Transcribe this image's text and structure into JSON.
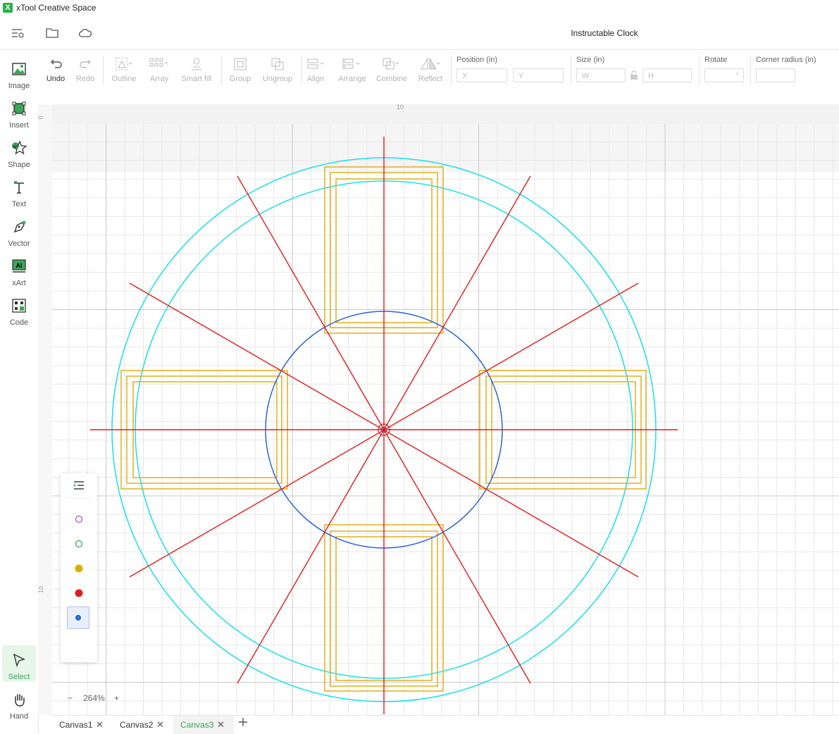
{
  "app": {
    "title": "xTool Creative Space",
    "logo_glyph": "X"
  },
  "document": {
    "title": "Instructable Clock"
  },
  "sidebar": {
    "tools": [
      {
        "label": "Image",
        "icon": "image-icon"
      },
      {
        "label": "Insert",
        "icon": "insert-icon"
      },
      {
        "label": "Shape",
        "icon": "star-icon"
      },
      {
        "label": "Text",
        "icon": "text-icon"
      },
      {
        "label": "Vector",
        "icon": "pen-icon"
      },
      {
        "label": "xArt",
        "icon": "ai-icon"
      },
      {
        "label": "Code",
        "icon": "qr-code-icon"
      }
    ],
    "bottom_tools": [
      {
        "label": "Select",
        "icon": "cursor-icon",
        "active": true
      },
      {
        "label": "Hand",
        "icon": "hand-icon"
      }
    ]
  },
  "toolbar": {
    "undo": "Undo",
    "redo": "Redo",
    "outline": "Outline",
    "array": "Array",
    "smart_fill": "Smart fill",
    "group": "Group",
    "ungroup": "Ungroup",
    "align": "Align",
    "arrange": "Arrange",
    "combine": "Combine",
    "reflect": "Reflect",
    "position_label": "Position (in)",
    "x_placeholder": "X",
    "y_placeholder": "Y",
    "size_label": "Size (in)",
    "w_placeholder": "W",
    "h_placeholder": "H",
    "rotate_label": "Rotate",
    "rotate_unit": "°",
    "corner_label": "Corner radius (in)"
  },
  "rulers": {
    "top_tick": "10",
    "left_tick_top": "0",
    "left_tick_bottom": "10"
  },
  "layers": [
    {
      "color": "#b04bd1",
      "filled": false
    },
    {
      "color": "#2fa84f",
      "filled": false
    },
    {
      "color": "#d8b000",
      "filled": true
    },
    {
      "color": "#e02020",
      "filled": true
    },
    {
      "color": "#2f6fe8",
      "filled": true,
      "selected": true
    }
  ],
  "zoom": {
    "level": "264%",
    "minus": "−",
    "plus": "+"
  },
  "tabs": [
    {
      "label": "Canvas1",
      "active": false
    },
    {
      "label": "Canvas2",
      "active": false
    },
    {
      "label": "Canvas3",
      "active": true
    }
  ],
  "colors": {
    "cyan_circle": "#19e0e8",
    "blue_circle": "#2b63d9",
    "red_line": "#e51b1b",
    "yellow_rect": "#e0b11c",
    "accent": "#3aa757"
  },
  "icons": [
    "menu-settings-icon",
    "folder-icon",
    "cloud-icon",
    "close-icon",
    "plus-icon",
    "lock-icon",
    "layers-list-icon"
  ]
}
